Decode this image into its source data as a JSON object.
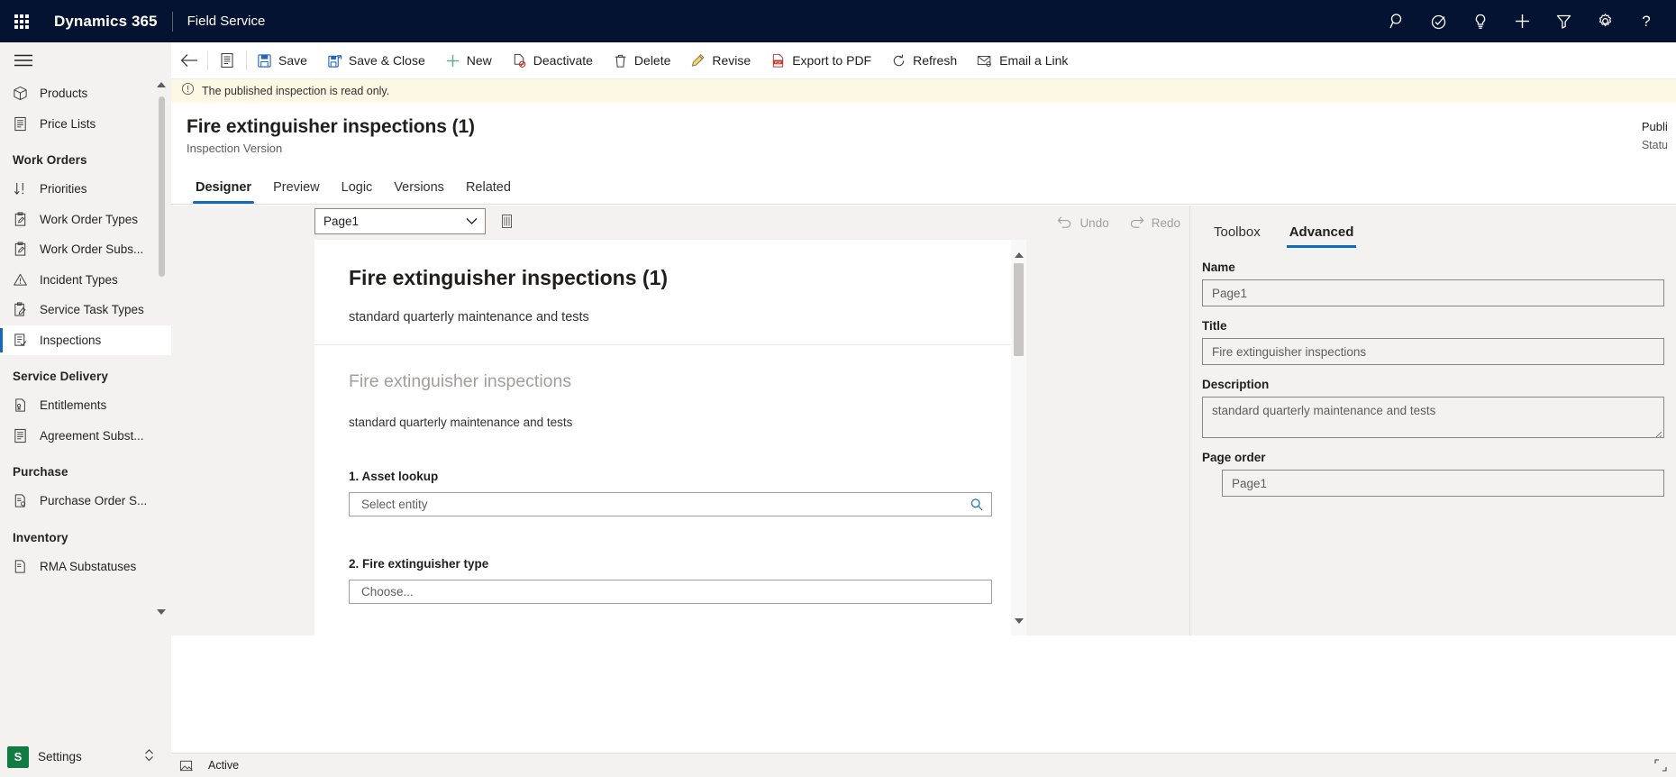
{
  "suitebar": {
    "waffle": "app-launcher",
    "brand": "Dynamics 365",
    "app_name": "Field Service",
    "icons": [
      "search-icon",
      "assistant-icon",
      "insights-lightbulb-icon",
      "quick-create-plus-icon",
      "filter-icon",
      "settings-gear-icon",
      "help-question-icon"
    ]
  },
  "sidebar": {
    "groups": [
      {
        "title": "",
        "items": [
          {
            "label": "Products",
            "icon": "product-box-icon",
            "selected": false
          },
          {
            "label": "Price Lists",
            "icon": "price-list-icon",
            "selected": false
          }
        ]
      },
      {
        "title": "Work Orders",
        "items": [
          {
            "label": "Priorities",
            "icon": "sort-priority-icon",
            "selected": false
          },
          {
            "label": "Work Order Types",
            "icon": "clipboard-pencil-icon",
            "selected": false
          },
          {
            "label": "Work Order Subs...",
            "icon": "clipboard-pencil-icon",
            "selected": false
          },
          {
            "label": "Incident Types",
            "icon": "warning-triangle-icon",
            "selected": false
          },
          {
            "label": "Service Task Types",
            "icon": "clipboard-task-icon",
            "selected": false
          },
          {
            "label": "Inspections",
            "icon": "inspection-checklist-icon",
            "selected": true
          }
        ]
      },
      {
        "title": "Service Delivery",
        "items": [
          {
            "label": "Entitlements",
            "icon": "entitlement-doc-icon",
            "selected": false
          },
          {
            "label": "Agreement Subst...",
            "icon": "agreement-doc-icon",
            "selected": false
          }
        ]
      },
      {
        "title": "Purchase",
        "items": [
          {
            "label": "Purchase Order S...",
            "icon": "purchase-order-icon",
            "selected": false
          }
        ]
      },
      {
        "title": "Inventory",
        "items": [
          {
            "label": "RMA Substatuses",
            "icon": "rma-doc-icon",
            "selected": false
          }
        ]
      }
    ],
    "settings": {
      "badge": "S",
      "label": "Settings",
      "chevron": "chevron-updown-icon"
    }
  },
  "commandbar": {
    "back": "back-arrow-icon",
    "form_selector": "form-selector-icon",
    "buttons": [
      {
        "label": "Save",
        "icon": "save-disk-icon"
      },
      {
        "label": "Save & Close",
        "icon": "save-close-icon"
      },
      {
        "label": "New",
        "icon": "plus-icon"
      },
      {
        "label": "Deactivate",
        "icon": "deactivate-doc-icon"
      },
      {
        "label": "Delete",
        "icon": "trash-icon"
      },
      {
        "label": "Revise",
        "icon": "pencil-icon"
      },
      {
        "label": "Export to PDF",
        "icon": "pdf-icon"
      },
      {
        "label": "Refresh",
        "icon": "refresh-icon"
      },
      {
        "label": "Email a Link",
        "icon": "email-link-icon"
      }
    ]
  },
  "banner": {
    "icon": "info-circle-icon",
    "text": "The published inspection is read only."
  },
  "record_header": {
    "title": "Fire extinguisher inspections (1)",
    "subtitle": "Inspection Version",
    "right_label": "Publi",
    "right_value": "Statu"
  },
  "tabs": [
    {
      "label": "Designer",
      "active": true
    },
    {
      "label": "Preview",
      "active": false
    },
    {
      "label": "Logic",
      "active": false
    },
    {
      "label": "Versions",
      "active": false
    },
    {
      "label": "Related",
      "active": false
    }
  ],
  "designer": {
    "page_selector": {
      "value": "Page1",
      "chevron": "chevron-down-icon"
    },
    "delete_page_icon": "delete-page-icon",
    "undo": {
      "label": "Undo",
      "icon": "undo-icon"
    },
    "redo": {
      "label": "Redo",
      "icon": "redo-icon"
    },
    "canvas": {
      "heading": "Fire extinguisher inspections (1)",
      "subheading": "standard quarterly maintenance and tests",
      "form_title": "Fire extinguisher inspections",
      "form_description": "standard quarterly maintenance and tests",
      "questions": [
        {
          "label": "1. Asset lookup",
          "placeholder": "Select entity",
          "icon": "lookup-search-icon"
        },
        {
          "label": "2. Fire extinguisher type",
          "placeholder": "Choose...",
          "icon": ""
        }
      ]
    },
    "scrollbar": {
      "up": "scroll-up-icon",
      "down": "scroll-down-icon"
    }
  },
  "properties": {
    "tabs": [
      {
        "label": "Toolbox",
        "active": false
      },
      {
        "label": "Advanced",
        "active": true
      }
    ],
    "fields": [
      {
        "label": "Name",
        "value": "Page1",
        "type": "text"
      },
      {
        "label": "Title",
        "value": "Fire extinguisher inspections",
        "type": "text"
      },
      {
        "label": "Description",
        "value": "standard quarterly maintenance and tests",
        "type": "textarea"
      },
      {
        "label": "Page order",
        "value": "Page1",
        "type": "order"
      }
    ]
  },
  "footer": {
    "icon": "form-notes-icon",
    "status": "Active",
    "right_icon": "expand-icon"
  },
  "colors": {
    "suitebar_bg": "#041332",
    "accent": "#0f6cbd",
    "nav_bg": "#f3f2f1",
    "banner_bg": "#fdf8e3",
    "settings_badge": "#107c41"
  }
}
